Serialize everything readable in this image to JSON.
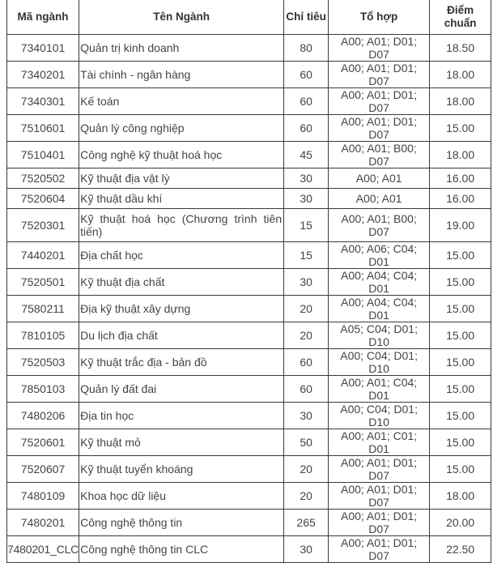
{
  "table": {
    "headers": {
      "code": "Mã ngành",
      "name": "Tên Ngành",
      "quota": "Chỉ tiêu",
      "combo": "Tổ hợp",
      "score": "Điểm chuẩn"
    },
    "rows": [
      {
        "code": "7340101",
        "name": "Quản trị kinh doanh",
        "quota": "80",
        "combo": "A00; A01; D01; D07",
        "score": "18.50"
      },
      {
        "code": "7340201",
        "name": "Tài chính - ngân hàng",
        "quota": "60",
        "combo": "A00; A01; D01; D07",
        "score": "18.00"
      },
      {
        "code": "7340301",
        "name": "Kế toán",
        "quota": "60",
        "combo": "A00; A01; D01; D07",
        "score": "18.00"
      },
      {
        "code": "7510601",
        "name": "Quản lý công nghiệp",
        "quota": "60",
        "combo": "A00; A01; D01; D07",
        "score": "15.00"
      },
      {
        "code": "7510401",
        "name": "Công nghệ kỹ thuật hoá học",
        "quota": "45",
        "combo": "A00; A01; B00; D07",
        "score": "18.00"
      },
      {
        "code": "7520502",
        "name": "Kỹ thuật địa vật lý",
        "quota": "30",
        "combo": "A00; A01",
        "score": "16.00"
      },
      {
        "code": "7520604",
        "name": "Kỹ thuật dầu khí",
        "quota": "30",
        "combo": "A00; A01",
        "score": "16.00"
      },
      {
        "code": "7520301",
        "name": "Kỹ thuật hoá học (Chương trình tiên tiến)",
        "quota": "15",
        "combo": "A00; A01; B00; D07",
        "score": "19.00"
      },
      {
        "code": "7440201",
        "name": "Địa chất học",
        "quota": "15",
        "combo": "A00; A06; C04; D01",
        "score": "15.00"
      },
      {
        "code": "7520501",
        "name": "Kỹ thuật địa chất",
        "quota": "30",
        "combo": "A00; A04; C04; D01",
        "score": "15.00"
      },
      {
        "code": "7580211",
        "name": "Địa kỹ thuật xây dựng",
        "quota": "20",
        "combo": "A00; A04; C04; D01",
        "score": "15.00"
      },
      {
        "code": "7810105",
        "name": "Du lịch địa chất",
        "quota": "20",
        "combo": "A05; C04; D01; D10",
        "score": "15.00"
      },
      {
        "code": "7520503",
        "name": "Kỹ thuật trắc địa - bản đồ",
        "quota": "60",
        "combo": "A00; C04; D01; D10",
        "score": "15.00"
      },
      {
        "code": "7850103",
        "name": "Quản lý đất đai",
        "quota": "60",
        "combo": "A00; A01; C04; D01",
        "score": "15.00"
      },
      {
        "code": "7480206",
        "name": "Địa tin học",
        "quota": "30",
        "combo": "A00; C04; D01; D10",
        "score": "15.00"
      },
      {
        "code": "7520601",
        "name": "Kỹ thuật mỏ",
        "quota": "50",
        "combo": "A00; A01; C01; D01",
        "score": "15.00"
      },
      {
        "code": "7520607",
        "name": "Kỹ thuật tuyển khoáng",
        "quota": "20",
        "combo": "A00; A01; D01; D07",
        "score": "15.00"
      },
      {
        "code": "7480109",
        "name": "Khoa học dữ liệu",
        "quota": "20",
        "combo": "A00; A01; D01; D07",
        "score": "18.00"
      },
      {
        "code": "7480201",
        "name": "Công nghệ thông tin",
        "quota": "265",
        "combo": "A00; A01; D01; D07",
        "score": "20.00"
      },
      {
        "code": "7480201_CLC",
        "name": "Công nghệ thông tin CLC",
        "quota": "30",
        "combo": "A00; A01; D01; D07",
        "score": "22.50"
      }
    ]
  }
}
